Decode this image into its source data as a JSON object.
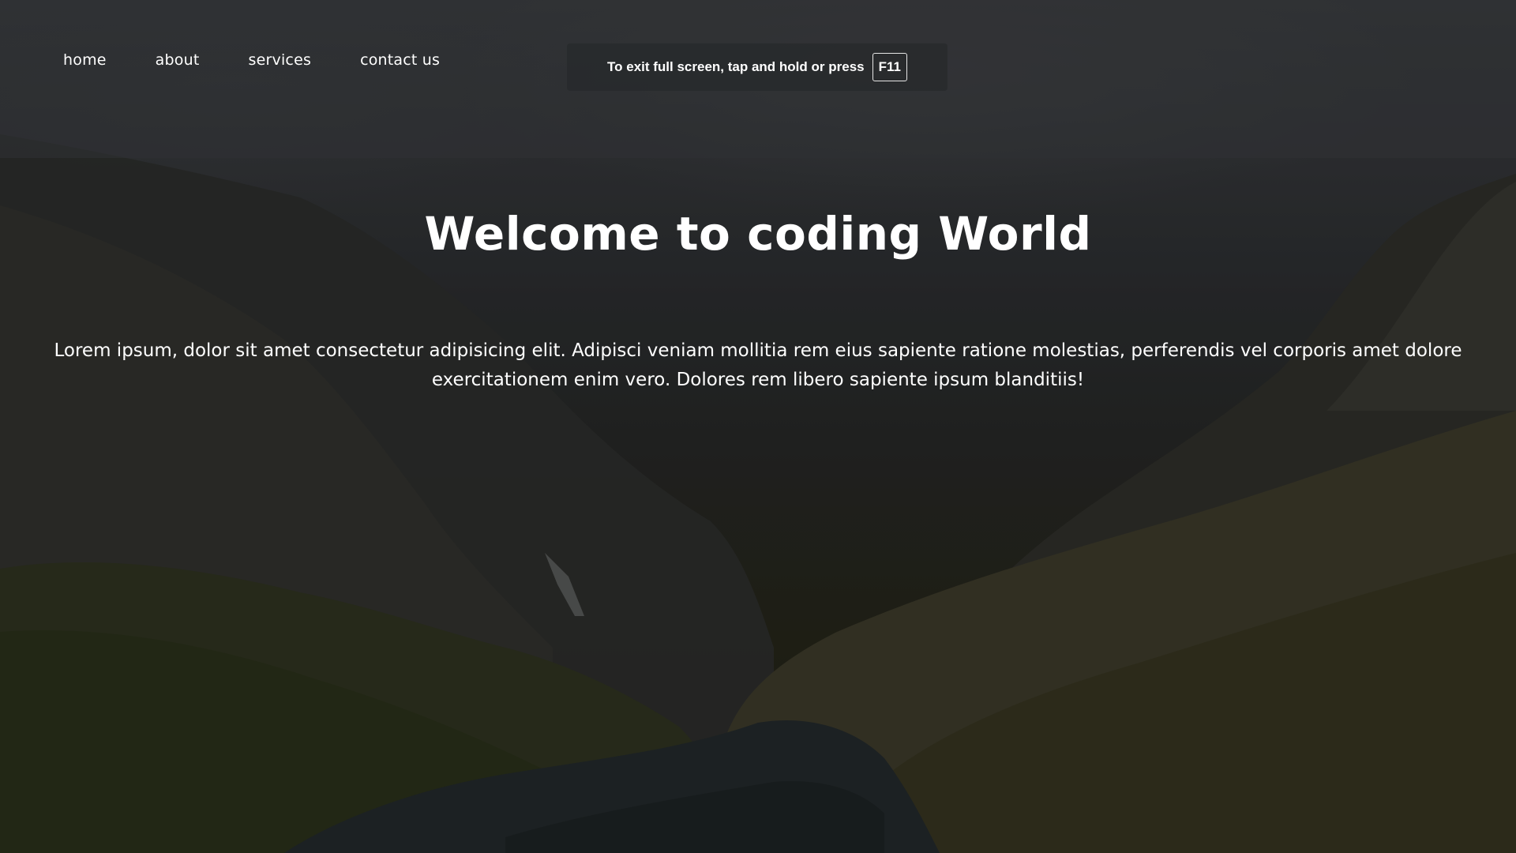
{
  "nav": {
    "items": [
      {
        "label": "home"
      },
      {
        "label": "about"
      },
      {
        "label": "services"
      },
      {
        "label": "contact us"
      }
    ]
  },
  "fullscreen_notice": {
    "text": "To exit full screen, tap and hold or press",
    "key": "F11"
  },
  "hero": {
    "title": "Welcome to coding World",
    "paragraph": "Lorem ipsum, dolor sit amet consectetur adipisicing elit. Adipisci veniam mollitia rem eius sapiente ratione molestias, perferendis vel corporis amet dolore exercitationem enim vero. Dolores rem libero sapiente ipsum blanditiis!"
  },
  "colors": {
    "text": "#ffffff",
    "toast_bg": "#2a2c2f"
  }
}
